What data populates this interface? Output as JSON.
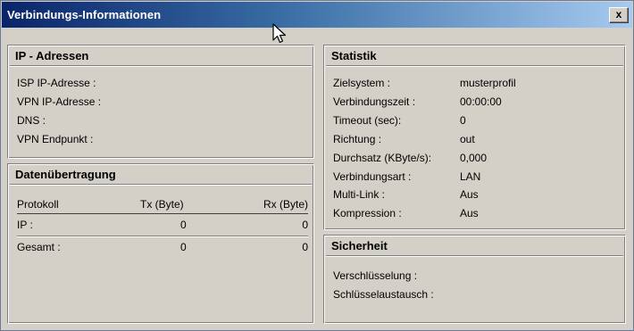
{
  "window": {
    "title": "Verbindungs-Informationen",
    "close_label": "x"
  },
  "ip_panel": {
    "title": "IP - Adressen",
    "rows": [
      {
        "label": "ISP IP-Adresse :",
        "value": ""
      },
      {
        "label": "VPN IP-Adresse :",
        "value": ""
      },
      {
        "label": "DNS :",
        "value": ""
      },
      {
        "label": "VPN Endpunkt :",
        "value": ""
      }
    ]
  },
  "transfer_panel": {
    "title": "Datenübertragung",
    "headers": {
      "protocol": "Protokoll",
      "tx": "Tx (Byte)",
      "rx": "Rx (Byte)"
    },
    "rows": [
      {
        "protocol": "IP :",
        "tx": "0",
        "rx": "0"
      }
    ],
    "total": {
      "protocol": "Gesamt :",
      "tx": "0",
      "rx": "0"
    }
  },
  "stats_panel": {
    "title": "Statistik",
    "rows": [
      {
        "label": "Zielsystem :",
        "value": "musterprofil"
      },
      {
        "label": "Verbindungszeit :",
        "value": "00:00:00"
      },
      {
        "label": "Timeout (sec):",
        "value": "0"
      },
      {
        "label": "Richtung :",
        "value": "out"
      },
      {
        "label": "Durchsatz (KByte/s):",
        "value": "0,000"
      },
      {
        "label": "Verbindungsart :",
        "value": "LAN"
      },
      {
        "label": "Multi-Link :",
        "value": "Aus"
      },
      {
        "label": "Kompression :",
        "value": "Aus"
      }
    ]
  },
  "security_panel": {
    "title": "Sicherheit",
    "rows": [
      {
        "label": "Verschlüsselung :",
        "value": ""
      },
      {
        "label": "Schlüsselaustausch :",
        "value": ""
      }
    ]
  }
}
